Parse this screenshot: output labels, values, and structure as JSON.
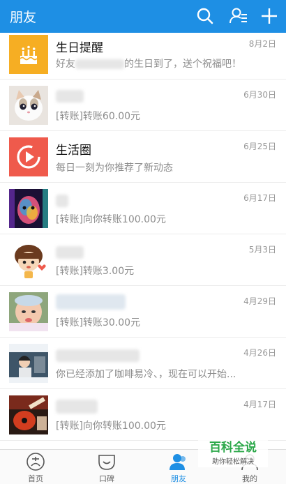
{
  "header": {
    "title": "朋友",
    "icons": [
      "search-icon",
      "contacts-icon",
      "plus-icon"
    ]
  },
  "conversations": [
    {
      "name": "生日提醒",
      "msg_prefix": "好友",
      "msg_suffix": "的生日到了，送个祝福吧！",
      "date": "8月2日",
      "avatar": "cake-icon"
    },
    {
      "name": "",
      "msg": "[转账]转账60.00元",
      "date": "6月30日",
      "avatar": "kitten-photo"
    },
    {
      "name": "生活圈",
      "msg": "每日一刻为你推荐了新动态",
      "date": "6月25日",
      "avatar": "play-icon"
    },
    {
      "name": "",
      "msg": "[转账]向你转账100.00元",
      "date": "6月17日",
      "avatar": "colorful-face-photo"
    },
    {
      "name": "",
      "msg": "[转账]转账3.00元",
      "date": "5月3日",
      "avatar": "cartoon-boy-photo"
    },
    {
      "name": "",
      "msg": "[转账]转账30.00元",
      "date": "4月29日",
      "avatar": "baby-photo"
    },
    {
      "name": "",
      "msg": "你已经添加了咖啡易冷、，现在可以开始...",
      "date": "4月26日",
      "avatar": "person-photo"
    },
    {
      "name": "",
      "msg": "[转账]向你转账100.00元",
      "date": "4月17日",
      "avatar": "guitar-photo"
    }
  ],
  "tabs": [
    {
      "label": "首页",
      "icon": "alipay-icon",
      "active": false
    },
    {
      "label": "口碑",
      "icon": "koubei-icon",
      "active": false
    },
    {
      "label": "朋友",
      "icon": "friends-icon",
      "active": true
    },
    {
      "label": "我的",
      "icon": "profile-icon",
      "active": false
    }
  ],
  "watermark": {
    "title": "百科全说",
    "subtitle": "助你轻松解决"
  },
  "colors": {
    "brand": "#1e8fe4",
    "birthday_bg": "#f6ae23",
    "life_bg": "#ef5a4c",
    "watermark": "#2ca84a"
  }
}
